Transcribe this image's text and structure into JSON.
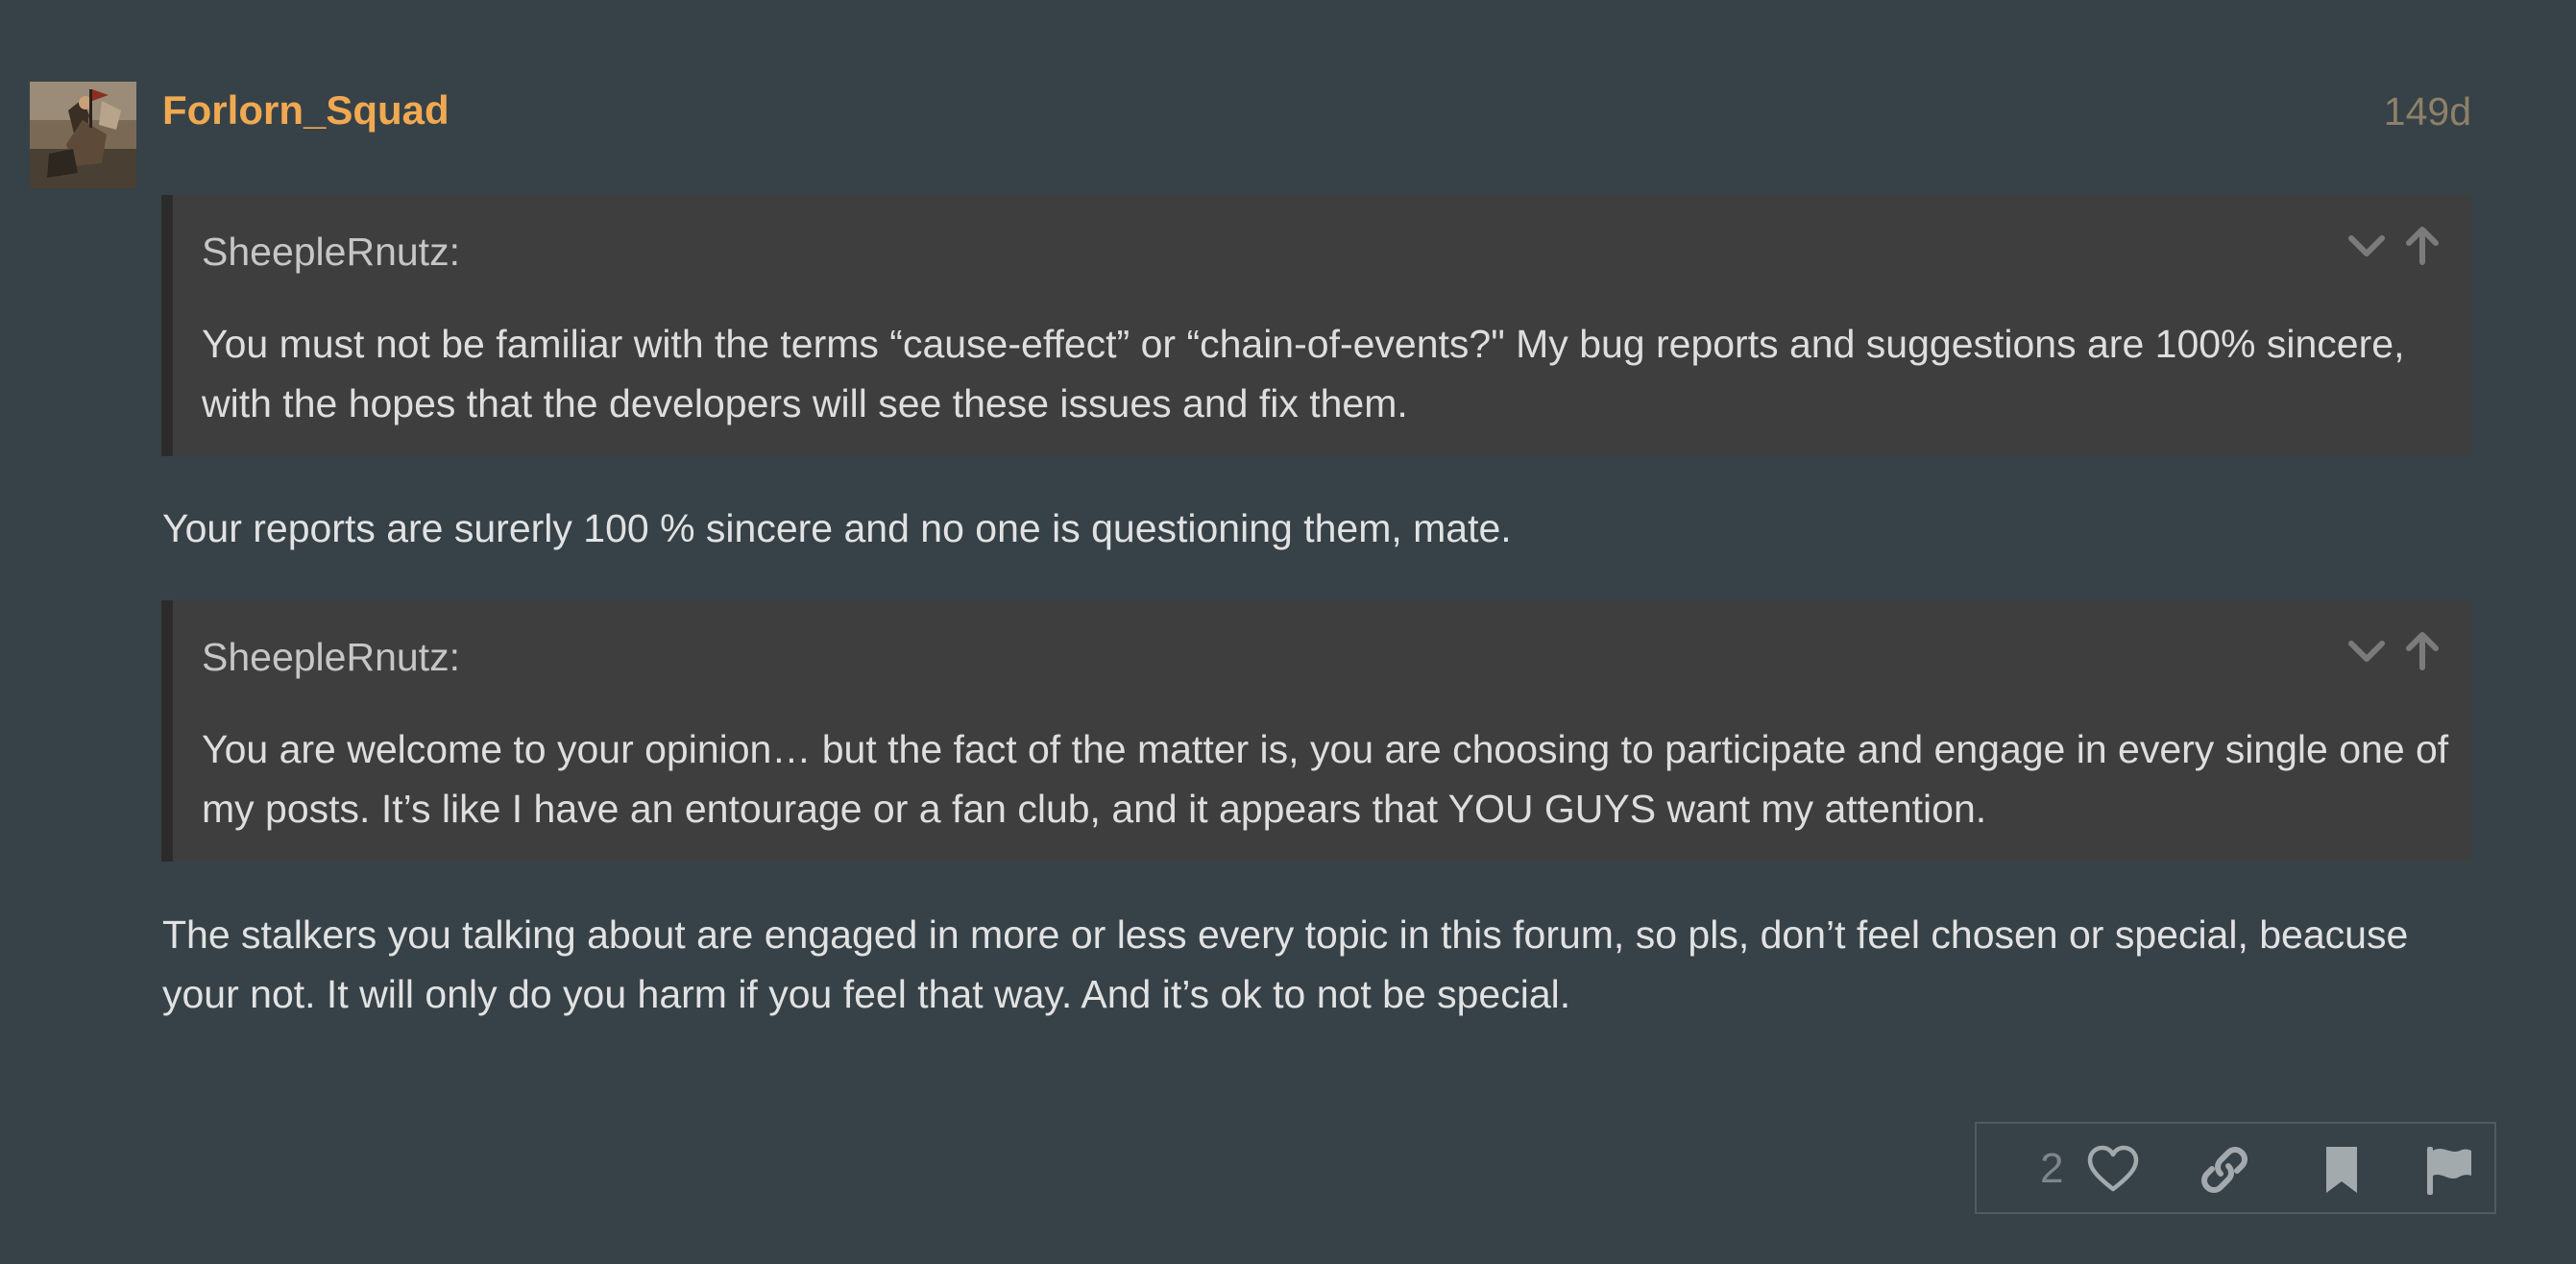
{
  "post": {
    "author": "Forlorn_Squad",
    "age": "149d",
    "avatar_icon": "painting-avatar"
  },
  "quotes": [
    {
      "author": "SheepleRnutz:",
      "text": "You must not be familiar with the terms “cause-effect” or “chain-of-events?\" My bug reports and suggestions are 100% sincere, with the hopes that the developers will see these issues and fix them."
    },
    {
      "author": "SheepleRnutz:",
      "text": "You are welcome to your opinion… but the fact of the matter is, you are choosing to participate and engage in every single one of my posts. It’s like I have an entourage or a fan club, and it appears that YOU GUYS want my attention."
    }
  ],
  "replies": [
    "Your reports are surerly 100 % sincere and no one is questioning them, mate.",
    "The stalkers you talking about are engaged in more or less every topic in this forum, so pls, don’t feel chosen or special, beacuse your not. It will only do you harm if you feel that way. And it’s ok to not be special."
  ],
  "actions": {
    "like_count": "2",
    "icons": [
      "heart-icon",
      "link-icon",
      "bookmark-icon",
      "flag-icon"
    ]
  },
  "colors": {
    "background": "#374248",
    "username": "#f0a951",
    "quote_background": "#3e3e3e",
    "text": "#e2e2e2"
  }
}
